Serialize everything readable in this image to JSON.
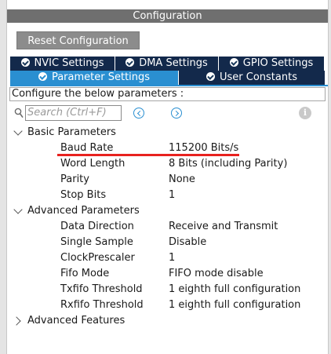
{
  "window": {
    "title": "Configuration"
  },
  "toolbar": {
    "reset_label": "Reset Configuration"
  },
  "tabs": {
    "row1": [
      {
        "label": "NVIC Settings",
        "icon": "check-circle-icon"
      },
      {
        "label": "DMA Settings",
        "icon": "check-circle-icon"
      },
      {
        "label": "GPIO Settings",
        "icon": "check-circle-icon"
      }
    ],
    "row2": [
      {
        "label": "Parameter Settings",
        "icon": "check-circle-icon",
        "active": true
      },
      {
        "label": "User Constants",
        "icon": "check-circle-icon",
        "active": false
      }
    ]
  },
  "hint": "Configure the below parameters :",
  "search": {
    "placeholder": "Search (Ctrl+F)"
  },
  "colors": {
    "accent": "#2a8fd1",
    "tab_dark": "#13294b",
    "highlight": "#e8221f",
    "title_bar": "#6f6f6f"
  },
  "groups": {
    "basic": {
      "label": "Basic Parameters",
      "expanded": true,
      "params": [
        {
          "name": "Baud Rate",
          "value": "115200 Bits/s"
        },
        {
          "name": "Word Length",
          "value": "8 Bits (including Parity)"
        },
        {
          "name": "Parity",
          "value": "None"
        },
        {
          "name": "Stop Bits",
          "value": "1"
        }
      ]
    },
    "advanced": {
      "label": "Advanced Parameters",
      "expanded": true,
      "params": [
        {
          "name": "Data Direction",
          "value": "Receive and Transmit"
        },
        {
          "name": "Single Sample",
          "value": "Disable"
        },
        {
          "name": "ClockPrescaler",
          "value": "1"
        },
        {
          "name": "Fifo Mode",
          "value": "FIFO mode disable"
        },
        {
          "name": "Txfifo Threshold",
          "value": "1 eighth full configuration"
        },
        {
          "name": "Rxfifo Threshold",
          "value": "1 eighth full configuration"
        }
      ]
    },
    "features": {
      "label": "Advanced Features",
      "expanded": false
    }
  }
}
